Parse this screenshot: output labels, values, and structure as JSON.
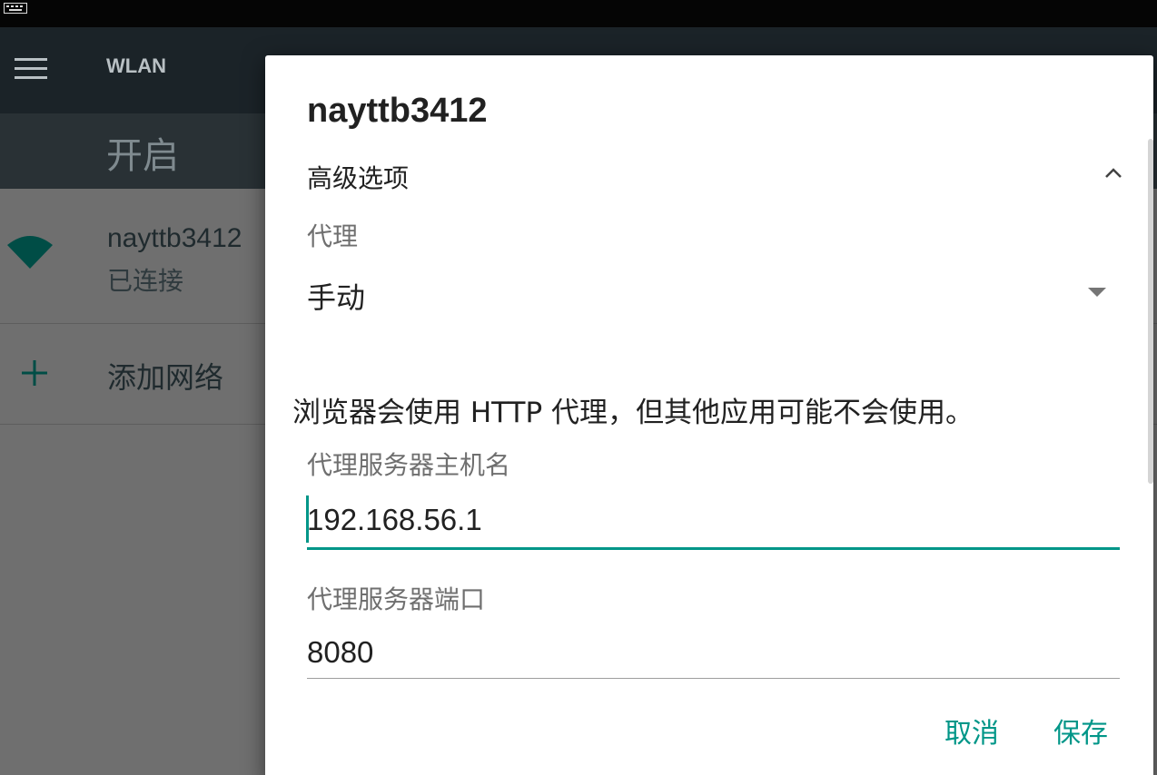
{
  "status_bar": {
    "keyboard_icon": "keyboard-icon"
  },
  "toolbar": {
    "title": "WLAN",
    "menu_icon": "menu-icon"
  },
  "switch": {
    "label": "开启"
  },
  "network_list": {
    "items": [
      {
        "name": "nayttb3412",
        "status": "已连接",
        "icon": "wifi-icon"
      }
    ],
    "add_label": "添加网络"
  },
  "dialog": {
    "title": "nayttb3412",
    "advanced_label": "高级选项",
    "proxy_label": "代理",
    "proxy_value": "手动",
    "warning": "浏览器会使用 HTTP 代理，但其他应用可能不会使用。",
    "host_label": "代理服务器主机名",
    "host_value": "192.168.56.1",
    "port_label": "代理服务器端口",
    "port_value": "8080",
    "cancel_label": "取消",
    "save_label": "保存"
  },
  "colors": {
    "accent": "#009688",
    "toolbar": "#1b2328",
    "scrim_list": "#6f6f6f",
    "wifi_icon": "#004d46"
  }
}
